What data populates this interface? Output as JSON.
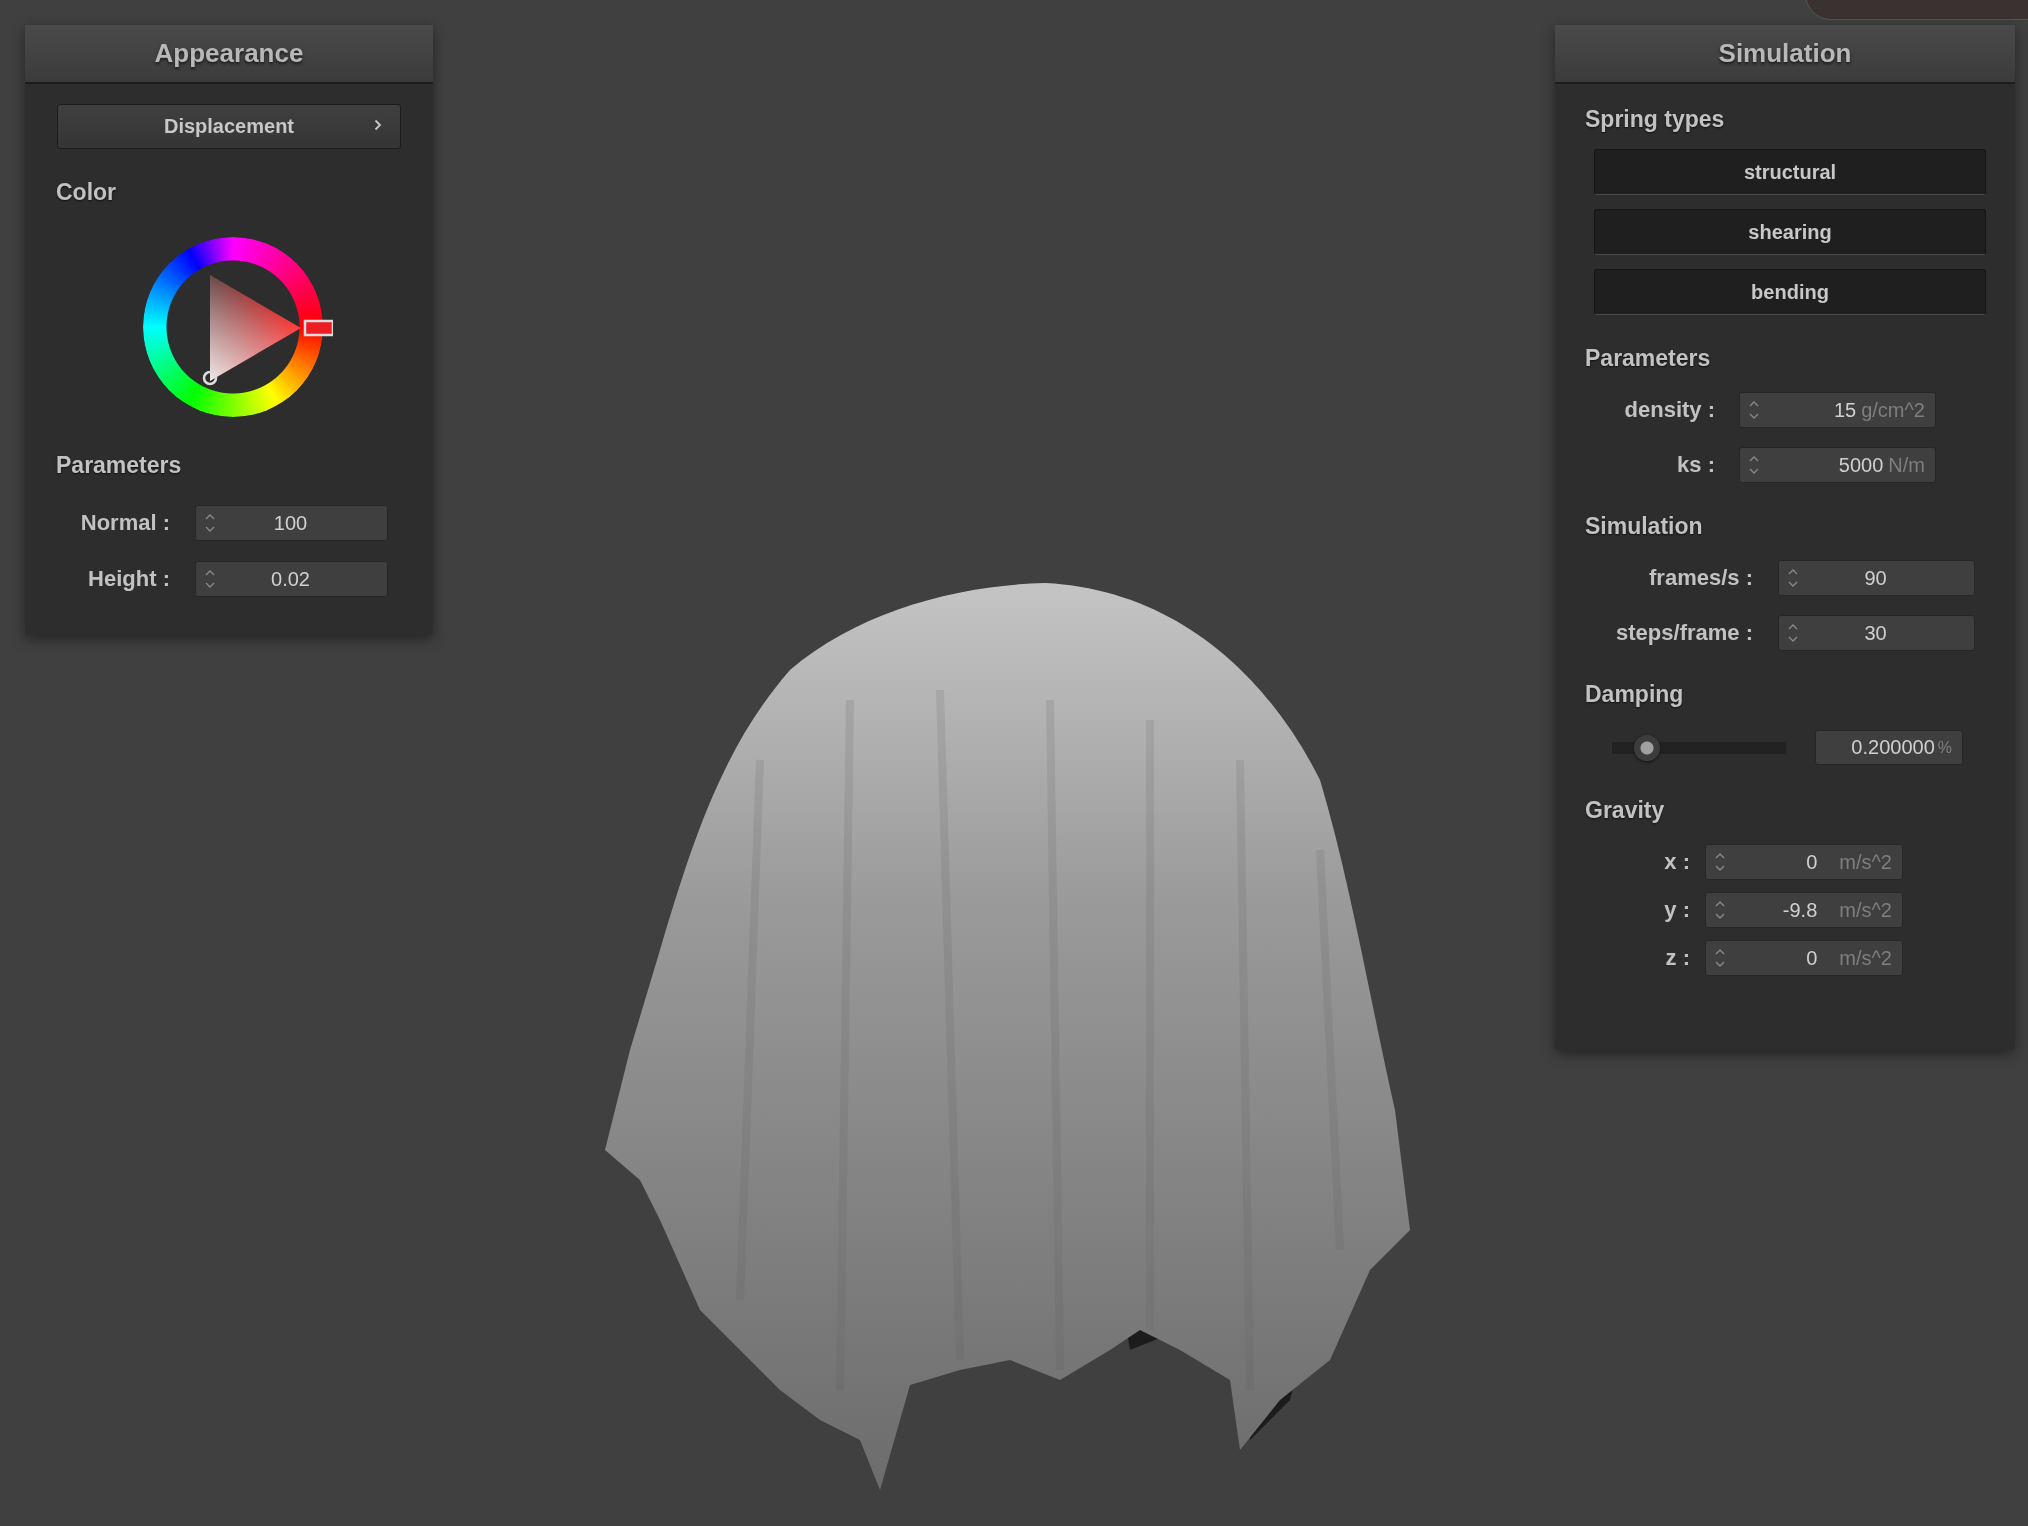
{
  "appearance_panel": {
    "title": "Appearance",
    "dropdown": {
      "label": "Displacement"
    },
    "color_heading": "Color",
    "parameters_heading": "Parameters",
    "fields": [
      {
        "label": "Normal :",
        "value": "100"
      },
      {
        "label": "Height :",
        "value": "0.02"
      }
    ]
  },
  "simulation_panel": {
    "title": "Simulation",
    "spring_types_heading": "Spring types",
    "spring_types": [
      "structural",
      "shearing",
      "bending"
    ],
    "parameters_heading": "Parameters",
    "parameters": [
      {
        "label": "density :",
        "value": "15",
        "unit": "g/cm^2"
      },
      {
        "label": "ks :",
        "value": "5000",
        "unit": "N/m"
      }
    ],
    "simulation_heading": "Simulation",
    "simulation": [
      {
        "label": "frames/s :",
        "value": "90"
      },
      {
        "label": "steps/frame :",
        "value": "30"
      }
    ],
    "damping_heading": "Damping",
    "damping": {
      "level": 0.2,
      "value": "0.200000",
      "unit": "%"
    },
    "gravity_heading": "Gravity",
    "gravity": [
      {
        "label": "x :",
        "value": "0",
        "unit": "m/s^2"
      },
      {
        "label": "y :",
        "value": "-9.8",
        "unit": "m/s^2"
      },
      {
        "label": "z :",
        "value": "0",
        "unit": "m/s^2"
      }
    ]
  }
}
